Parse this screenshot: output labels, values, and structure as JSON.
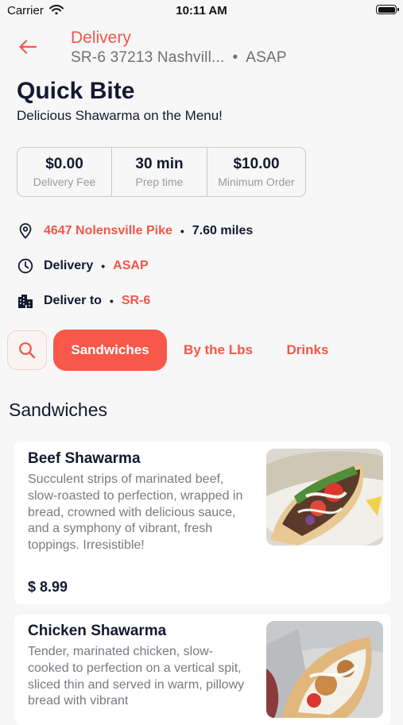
{
  "status_bar": {
    "carrier": "Carrier",
    "time": "10:11 AM"
  },
  "header": {
    "title": "Delivery",
    "address": "SR-6 37213 Nashvill...",
    "separator": "•",
    "timing": "ASAP"
  },
  "store": {
    "name": "Quick Bite",
    "tagline": "Delicious Shawarma on the Menu!"
  },
  "stats": [
    {
      "value": "$0.00",
      "label": "Delivery Fee"
    },
    {
      "value": "30 min",
      "label": "Prep time"
    },
    {
      "value": "$10.00",
      "label": "Minimum Order"
    }
  ],
  "info": {
    "address": "4647 Nolensville Pike",
    "distance": "7.60 miles",
    "mode_label": "Delivery",
    "mode_value": "ASAP",
    "deliver_to_label": "Deliver to",
    "deliver_to_value": "SR-6",
    "bullet": "•"
  },
  "tabs": [
    {
      "label": "Sandwiches",
      "active": true
    },
    {
      "label": "By the Lbs",
      "active": false
    },
    {
      "label": "Drinks",
      "active": false
    }
  ],
  "section_title": "Sandwiches",
  "menu_items": [
    {
      "name": "Beef Shawarma",
      "description": "Succulent strips of marinated beef, slow-roasted to perfection, wrapped in bread, crowned with delicious sauce, and a symphony of vibrant, fresh toppings. Irresistible!",
      "price": "$ 8.99"
    },
    {
      "name": "Chicken Shawarma",
      "description": "Tender, marinated chicken, slow-cooked to perfection on a vertical spit, sliced thin and served in warm, pillowy bread with vibrant"
    }
  ],
  "colors": {
    "accent": "#f0574a",
    "tab_active_bg": "#f8584a",
    "text_dark": "#15182f",
    "text_muted": "#7a7a80",
    "background": "#f7f7f7"
  },
  "icons": [
    "wifi-icon",
    "battery-icon",
    "back-arrow-icon",
    "location-pin-icon",
    "clock-icon",
    "building-icon",
    "search-icon"
  ]
}
